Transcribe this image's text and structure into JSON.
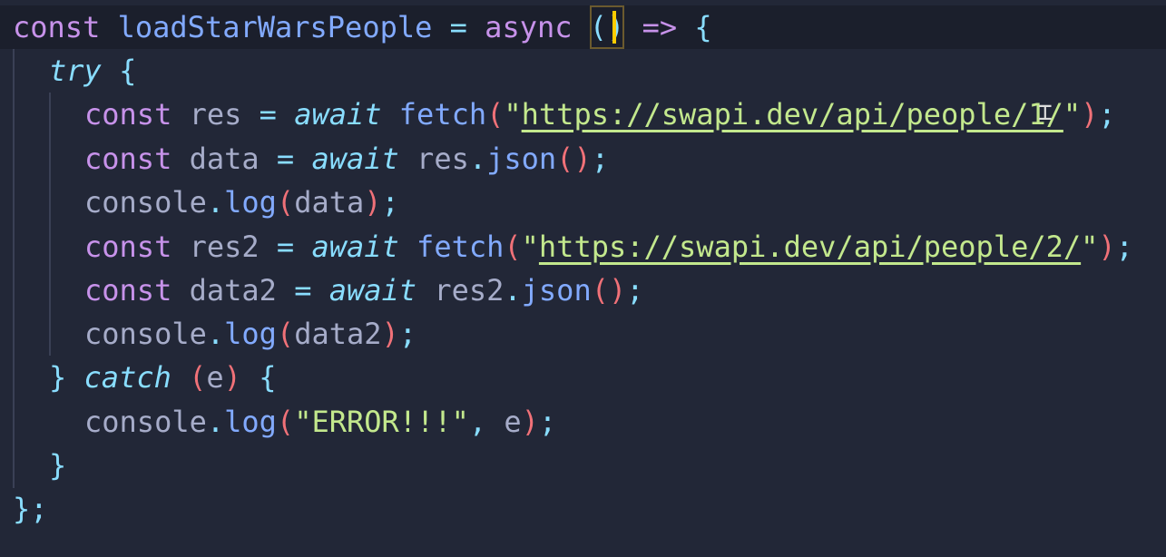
{
  "editor": {
    "lines": {
      "l1": {
        "kw_const": "const",
        "name": "loadStarWarsPeople",
        "eq": "=",
        "kw_async": "async",
        "lparen": "(",
        "rparen": ")",
        "arrow": "=>",
        "brace": "{"
      },
      "l2": {
        "kw_try": "try",
        "brace": "{"
      },
      "l3": {
        "kw_const": "const",
        "var": "res",
        "eq": "=",
        "kw_await": "await",
        "fn": "fetch",
        "lparen": "(",
        "q1": "\"",
        "url": "https://swapi.dev/api/people/1/",
        "q2": "\"",
        "rparen": ")",
        "semi": ";"
      },
      "l4": {
        "kw_const": "const",
        "var": "data",
        "eq": "=",
        "kw_await": "await",
        "obj": "res",
        "dot": ".",
        "fn": "json",
        "parens": "()",
        "semi": ";"
      },
      "l5": {
        "obj": "console",
        "dot": ".",
        "fn": "log",
        "lparen": "(",
        "arg": "data",
        "rparen": ")",
        "semi": ";"
      },
      "l6": {
        "kw_const": "const",
        "var": "res2",
        "eq": "=",
        "kw_await": "await",
        "fn": "fetch",
        "lparen": "(",
        "q1": "\"",
        "url": "https://swapi.dev/api/people/2/",
        "q2": "\"",
        "rparen": ")",
        "semi": ";"
      },
      "l7": {
        "kw_const": "const",
        "var": "data2",
        "eq": "=",
        "kw_await": "await",
        "obj": "res2",
        "dot": ".",
        "fn": "json",
        "parens": "()",
        "semi": ";"
      },
      "l8": {
        "obj": "console",
        "dot": ".",
        "fn": "log",
        "lparen": "(",
        "arg": "data2",
        "rparen": ")",
        "semi": ";"
      },
      "l9": {
        "rbrace": "}",
        "kw_catch": "catch",
        "lparen": "(",
        "arg": "e",
        "rparen": ")",
        "brace": "{"
      },
      "l10": {
        "obj": "console",
        "dot": ".",
        "fn": "log",
        "lparen": "(",
        "str": "\"ERROR!!!\"",
        "comma": ",",
        "arg": "e",
        "rparen": ")",
        "semi": ";"
      },
      "l11": {
        "rbrace": "}"
      },
      "l12": {
        "rbrace": "}",
        "semi": ";"
      }
    },
    "colors": {
      "background": "#222737",
      "keyword": "#c792ea",
      "italic_keyword": "#89ddff",
      "function": "#82aaff",
      "string": "#c3e88d",
      "paren": "#f07178",
      "cursor": "#ffcc00"
    }
  }
}
